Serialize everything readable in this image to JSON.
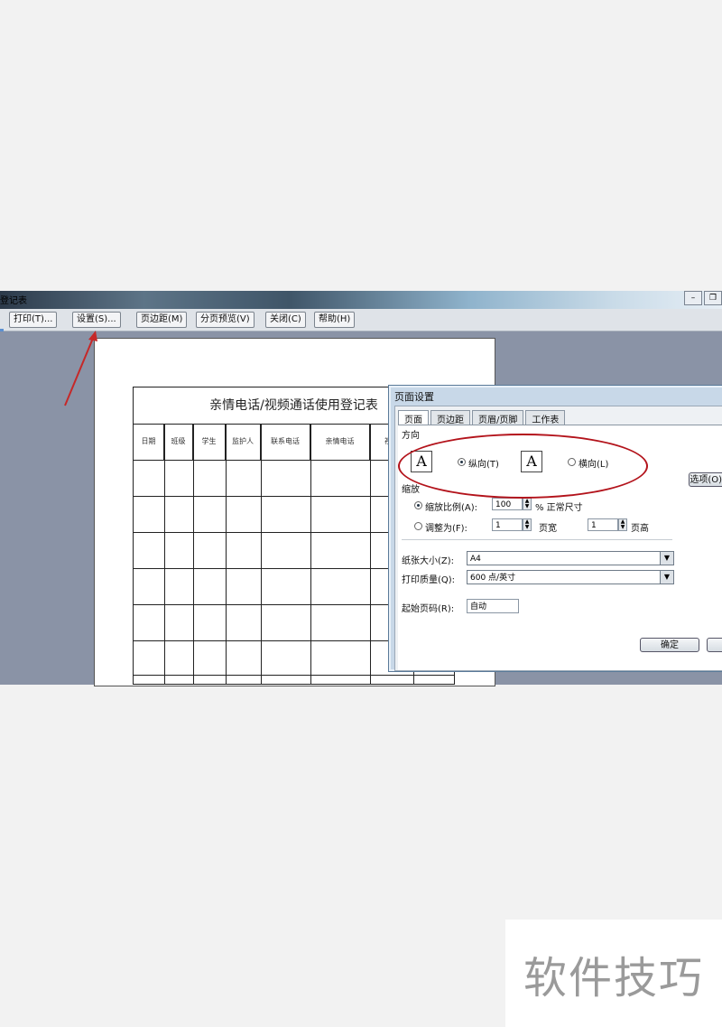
{
  "window": {
    "title": "登记表"
  },
  "toolbar": {
    "print": "打印(T)...",
    "setup": "设置(S)...",
    "margins": "页边距(M)",
    "page_break_preview": "分页预览(V)",
    "close": "关闭(C)",
    "help": "帮助(H)"
  },
  "sheet": {
    "title": "亲情电话/视频通话使用登记表",
    "headers": [
      "日期",
      "班级",
      "学生",
      "监护人",
      "联系电话",
      "亲情电话",
      "视频"
    ]
  },
  "dialog": {
    "title": "页面设置",
    "tabs": [
      "页面",
      "页边距",
      "页眉/页脚",
      "工作表"
    ],
    "orientation": {
      "section_label": "方向",
      "portrait_label": "纵向(T)",
      "landscape_label": "横向(L)",
      "selected": "portrait",
      "icon_glyph": "A"
    },
    "scaling": {
      "section_label": "缩放",
      "adjust_ratio_label": "缩放比例(A):",
      "ratio_value": "100",
      "ratio_suffix": "% 正常尺寸",
      "fit_label": "调整为(F):",
      "pages_wide_value": "1",
      "pages_wide_label": "页宽",
      "pages_tall_value": "1",
      "pages_tall_label": "页高"
    },
    "paper_size_label": "纸张大小(Z):",
    "paper_size_value": "A4",
    "print_quality_label": "打印质量(Q):",
    "print_quality_value": "600 点/英寸",
    "first_page_label": "起始页码(R):",
    "first_page_value": "自动",
    "options_button": "选项(O)...",
    "ok_button": "确定"
  },
  "watermark": {
    "text": "软件技巧"
  },
  "colors": {
    "annotation_red": "#b3131b",
    "preview_bg": "#8a93a6"
  }
}
